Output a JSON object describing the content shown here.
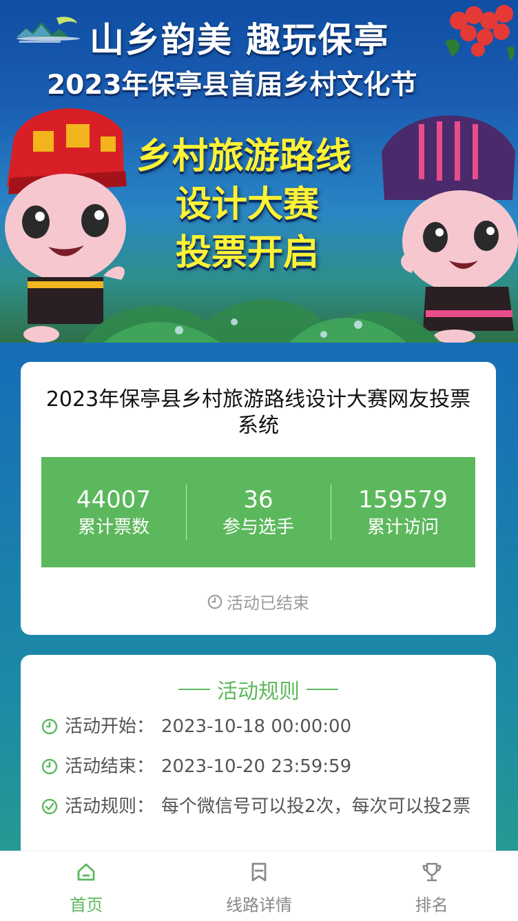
{
  "banner": {
    "headline1": "山乡韵美 趣玩保亭",
    "headline2": "2023年保亭县首届乡村文化节",
    "subline1": "乡村旅游路线",
    "subline2": "设计大赛",
    "subline3": "投票开启"
  },
  "info": {
    "title": "2023年保亭县乡村旅游路线设计大赛网友投票系统",
    "stats": [
      {
        "value": "44007",
        "label": "累计票数"
      },
      {
        "value": "36",
        "label": "参与选手"
      },
      {
        "value": "159579",
        "label": "累计访问"
      }
    ],
    "status": "活动已结束"
  },
  "rules": {
    "title": "活动规则",
    "items": [
      {
        "key": "活动开始：",
        "value": "2023-10-18 00:00:00"
      },
      {
        "key": "活动结束：",
        "value": "2023-10-20 23:59:59"
      },
      {
        "key": "活动规则：",
        "value": "每个微信号可以投2次，每次可以投2票"
      }
    ]
  },
  "tabbar": {
    "items": [
      {
        "label": "首页",
        "icon": "home-icon",
        "active": true
      },
      {
        "label": "线路详情",
        "icon": "bookmark-icon",
        "active": false
      },
      {
        "label": "排名",
        "icon": "trophy-icon",
        "active": false
      }
    ]
  },
  "colors": {
    "accent": "#5cb85c",
    "background": "#176fb6",
    "banner_yellow": "#fff235"
  }
}
